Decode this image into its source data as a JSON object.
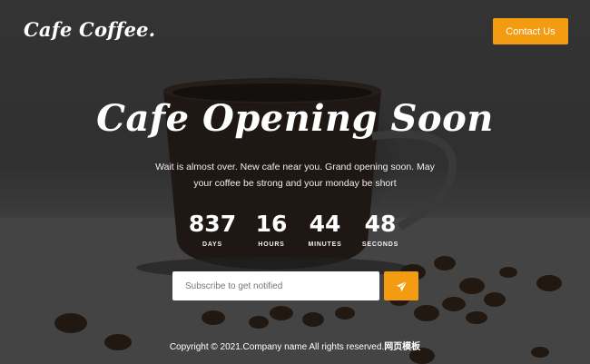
{
  "header": {
    "logo": "Cafe Coffee.",
    "contact_label": "Contact Us"
  },
  "hero": {
    "title": "Cafe Opening Soon",
    "tagline": "Wait is almost over. New cafe near you. Grand opening soon. May your coffee be strong and your monday be short"
  },
  "countdown": [
    {
      "value": "837",
      "label": "DAYS"
    },
    {
      "value": "16",
      "label": "HOURS"
    },
    {
      "value": "44",
      "label": "MINUTES"
    },
    {
      "value": "48",
      "label": "SECONDS"
    }
  ],
  "subscribe": {
    "placeholder": "Subscribe to get notified",
    "send_icon": "paper-plane-icon"
  },
  "footer": {
    "copyright": "Copyright © 2021.Company name All rights reserved.",
    "brand": "网页模板"
  },
  "colors": {
    "accent": "#f39c12",
    "text": "#ffffff"
  }
}
